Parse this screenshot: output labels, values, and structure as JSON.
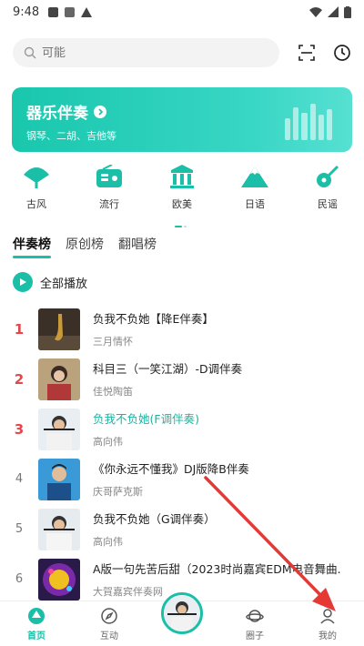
{
  "status": {
    "time": "9:48"
  },
  "search": {
    "placeholder": "可能"
  },
  "banner": {
    "title": "器乐伴奏",
    "subtitle": "钢琴、二胡、吉他等"
  },
  "categories": [
    {
      "label": "古风",
      "icon": "fan-icon"
    },
    {
      "label": "流行",
      "icon": "radio-icon"
    },
    {
      "label": "欧美",
      "icon": "columns-icon"
    },
    {
      "label": "日语",
      "icon": "mountain-icon"
    },
    {
      "label": "民谣",
      "icon": "guitar-icon"
    }
  ],
  "tabs": [
    "伴奏榜",
    "原创榜",
    "翻唱榜"
  ],
  "play_all": "全部播放",
  "songs": [
    {
      "rank": "1",
      "title": "负我不负她【降E伴奏】",
      "artist": "三月情怀"
    },
    {
      "rank": "2",
      "title": "科目三（一笑江湖）-D调伴奏",
      "artist": "佳悦陶笛"
    },
    {
      "rank": "3",
      "title": "负我不负她(F调伴奏)",
      "artist": "高向伟"
    },
    {
      "rank": "4",
      "title": "《你永远不懂我》DJ版降B伴奏",
      "artist": "庆哥萨克斯"
    },
    {
      "rank": "5",
      "title": "负我不负她（G调伴奏）",
      "artist": "高向伟"
    },
    {
      "rank": "6",
      "title": "A版一句先苦后甜（2023时尚嘉宾EDM电音舞曲...",
      "artist": "大賀嘉宾伴奏网"
    }
  ],
  "nav": {
    "home": "首页",
    "interact": "互动",
    "circle": "圈子",
    "mine": "我的"
  },
  "colors": {
    "accent": "#1bbfa8",
    "hot_rank": "#e2474b",
    "annotation": "#e53935"
  }
}
